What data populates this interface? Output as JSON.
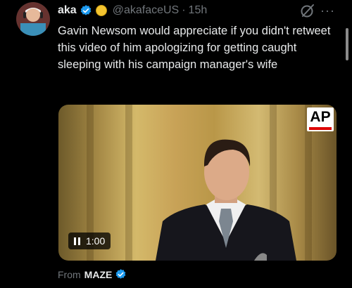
{
  "tweet": {
    "author_name": "aka",
    "handle": "@akafaceUS",
    "separator": "·",
    "time": "15h",
    "text": "Gavin Newsom would appreciate if you didn't retweet this video of him apologizing for getting caught sleeping with his campaign manager's wife",
    "more_label": "···"
  },
  "video": {
    "logo_text": "AP",
    "duration": "1:00",
    "playback_state": "paused"
  },
  "source": {
    "prefix": "From",
    "name": "MAZE"
  },
  "colors": {
    "background": "#000000",
    "text": "#e7e9ea",
    "secondary": "#71767b",
    "verified": "#1d9bf0"
  }
}
